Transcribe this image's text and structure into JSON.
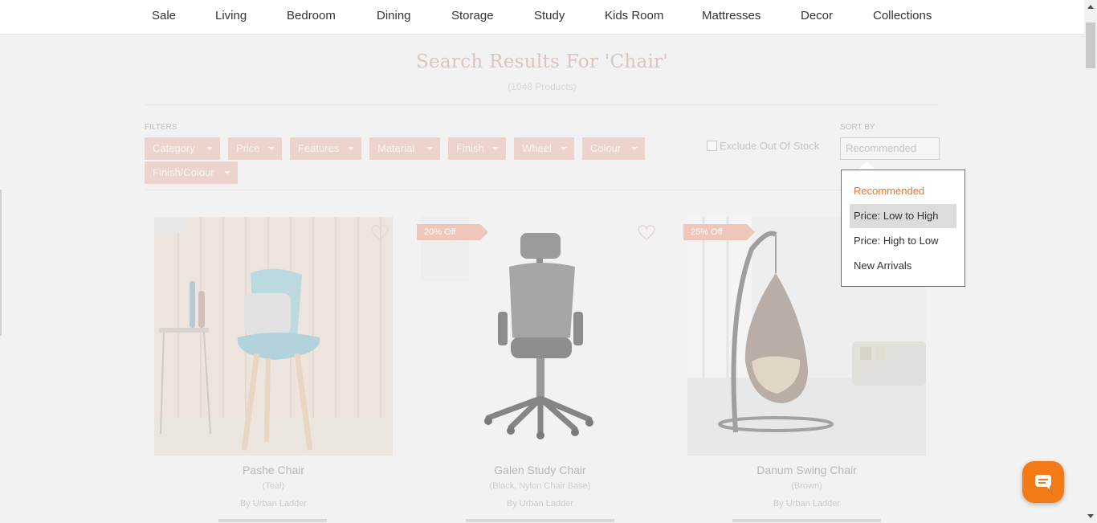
{
  "nav": {
    "items": [
      "Sale",
      "Living",
      "Bedroom",
      "Dining",
      "Storage",
      "Study",
      "Kids Room",
      "Mattresses",
      "Decor",
      "Collections"
    ]
  },
  "search": {
    "title": "Search Results For 'Chair'",
    "count": "(1048 Products)"
  },
  "filters": {
    "label": "FILTERS",
    "chips": [
      "Category",
      "Price",
      "Features",
      "Material",
      "Finish",
      "Wheel",
      "Colour",
      "Finish/Colour"
    ],
    "exclude_label": "Exclude Out Of Stock"
  },
  "sort": {
    "label": "SORT BY",
    "selected": "Recommended",
    "options": [
      "Recommended",
      "Price: Low to High",
      "Price: High to Low",
      "New Arrivals"
    ],
    "highlighted_option": "Price: Low to High"
  },
  "products": [
    {
      "name": "Pashe Chair",
      "variant": "(Teal)",
      "brand": "By Urban Ladder",
      "badge": ""
    },
    {
      "name": "Galen Study Chair",
      "variant": "(Black, Nylon Chair Base)",
      "brand": "By Urban Ladder",
      "badge": "20% Off"
    },
    {
      "name": "Danum Swing Chair",
      "variant": "(Brown)",
      "brand": "By Urban Ladder",
      "badge": "25% Off"
    }
  ],
  "colors": {
    "accent": "#f57224",
    "chip_bg": "#ecd4cc",
    "chat": "#f47a18"
  },
  "icons": [
    "heart-icon",
    "caret-down-icon",
    "chat-icon",
    "checkbox"
  ]
}
